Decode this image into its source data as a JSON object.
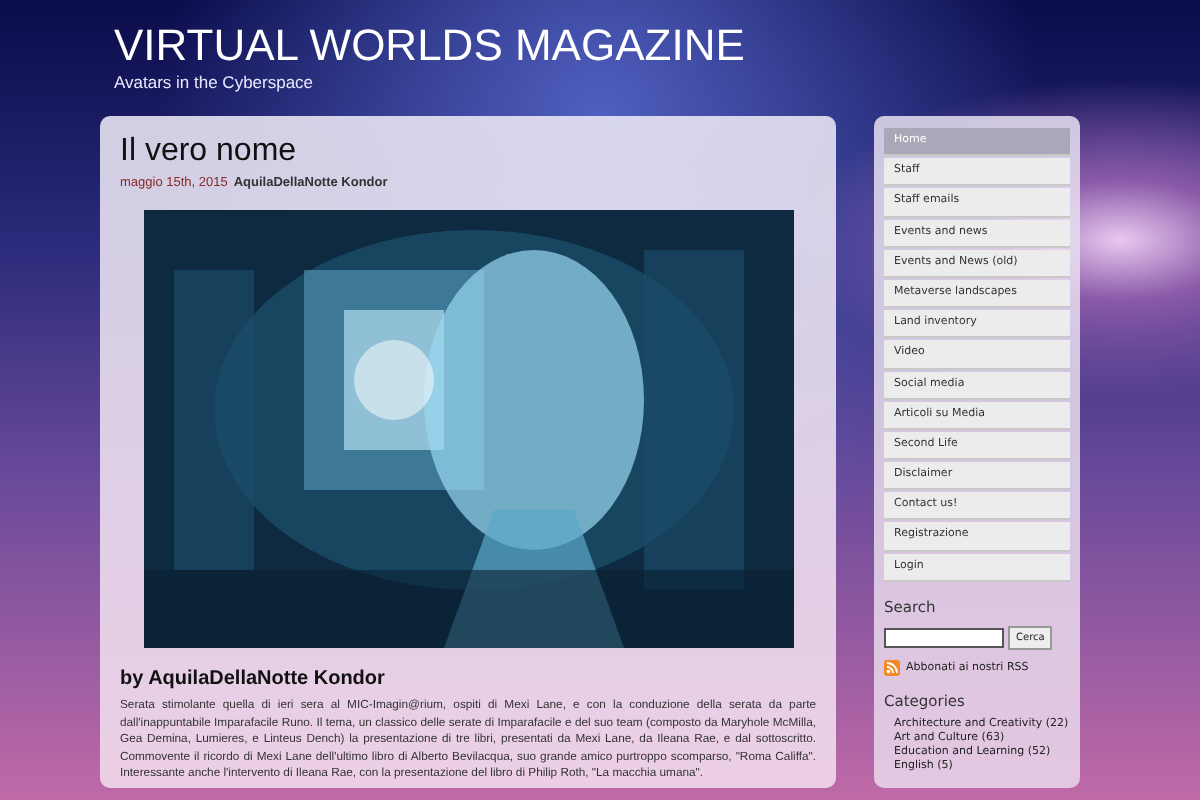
{
  "site": {
    "title": "VIRTUAL WORLDS MAGAZINE",
    "tagline": "Avatars in the Cyberspace"
  },
  "post": {
    "title": "Il vero nome",
    "date": "maggio 15th, 2015",
    "author": "AquilaDellaNotte Kondor",
    "byline": "by AquilaDellaNotte Kondor",
    "body": "Serata stimolante quella di ieri sera al MIC-Imagin@rium, ospiti di Mexi Lane, e con la conduzione della serata da parte dall'inappuntabile Imparafacile Runo. Il tema, un classico delle serate di Imparafacile e del suo team (composto da Maryhole McMilla, Gea Demina, Lumieres, e Linteus Dench) la presentazione di tre libri, presentati da Mexi Lane, da Ileana Rae, e dal sottoscritto. Commovente il ricordo di Mexi Lane dell'ultimo libro di Alberto Bevilacqua, suo grande amico purtroppo scomparso, \"Roma Califfa\". Interessante anche l'intervento di Ileana Rae, con la presentazione del libro di Philip Roth, \"La macchia umana\"."
  },
  "sidebar": {
    "menu": [
      {
        "label": "Home",
        "selected": true
      },
      {
        "label": "Staff",
        "selected": false
      },
      {
        "label": "Staff emails",
        "selected": false
      },
      {
        "label": "Events and news",
        "selected": false
      },
      {
        "label": "Events and News (old)",
        "selected": false
      },
      {
        "label": "Metaverse landscapes",
        "selected": false
      },
      {
        "label": "Land inventory",
        "selected": false
      },
      {
        "label": "Video",
        "selected": false
      },
      {
        "label": "Social media",
        "selected": false
      },
      {
        "label": "Articoli su Media",
        "selected": false
      },
      {
        "label": "Second Life",
        "selected": false
      },
      {
        "label": "Disclaimer",
        "selected": false
      },
      {
        "label": "Contact us!",
        "selected": false
      },
      {
        "label": "Registrazione",
        "selected": false
      },
      {
        "label": "Login",
        "selected": false
      }
    ],
    "search": {
      "heading": "Search",
      "button": "Cerca"
    },
    "rss": "Abbonati ai nostri RSS",
    "categories": {
      "heading": "Categories",
      "items": [
        "Architecture and Creativity (22)",
        "Art and Culture (63)",
        "Education and Learning (52)",
        "English (5)"
      ]
    }
  }
}
